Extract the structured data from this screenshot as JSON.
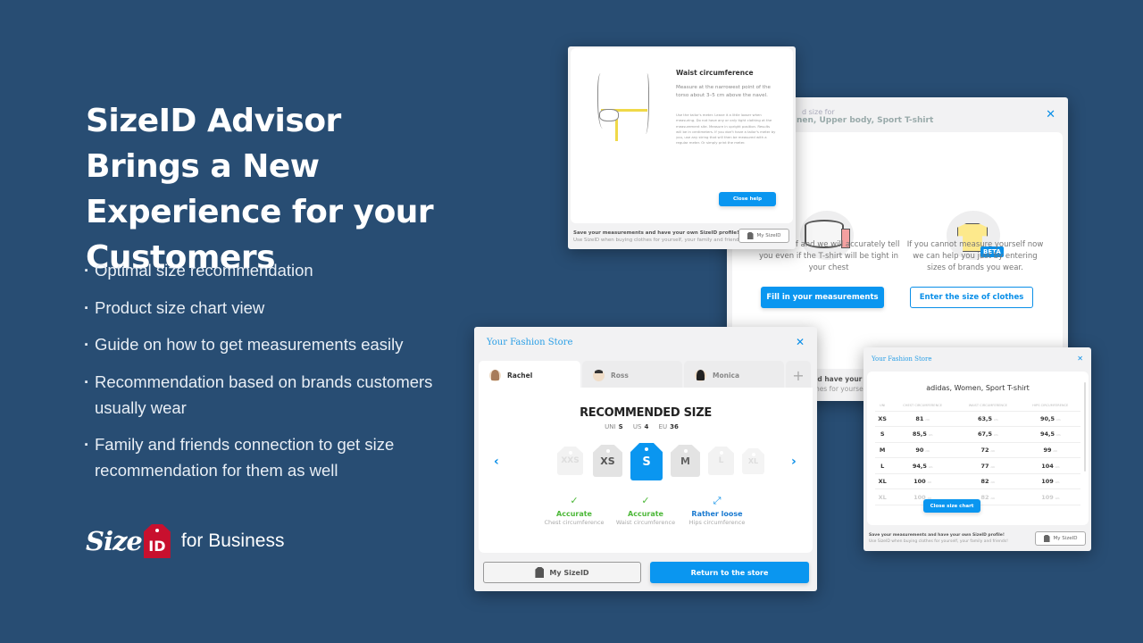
{
  "colors": {
    "background": "#284d73",
    "accent": "#0a96f0",
    "brand_red": "#c8102e",
    "accurate_green": "#4db839"
  },
  "headline": "SizeID Advisor Brings a New Experience for your Customers",
  "features": [
    "Optimal size recommendation",
    "Product size chart view",
    "Guide on how to get measurements easily",
    "Recommendation based on brands customers usually wear",
    "Family and friends connection to get size recommendation for them as well"
  ],
  "brand": {
    "size": "Size",
    "id": "ID",
    "suffix": "for Business"
  },
  "help_window": {
    "title": "Waist circumference",
    "subtitle": "Measure at the narrowest point of the torso about 3–5 cm above the navel.",
    "body": "Use the tailor's meter. Leave it a little looser when measuring. Do not have any or only tight clothing at the measurement site. Measure in upright position. Results will be in centimeters. If you don't have a tailor's meter by you, use any string that will then be measured with a regular meter. Or simply print the meter.",
    "close_button": "Close help",
    "footer_line1": "Save your measurements and have your own SizeID profile!",
    "footer_line2": "Use SizeID when buying clothes for yourself, your family and friends!",
    "mysizeid_button": "My SizeID"
  },
  "find_window": {
    "subtitle": "d size for",
    "title": "nen, Upper body, Sport T-shirt",
    "measure_text": "re yourself and we will accurately tell you even if the T-shirt will be tight in your chest",
    "brands_text": "If you cannot measure yourself now we can help you just by entering sizes of brands you wear.",
    "beta_badge": "BETA",
    "fill_button": "Fill in your measurements",
    "enter_button": "Enter the size of clothes",
    "footer_line1": "nd have your ow",
    "footer_line2": "thes for yourse"
  },
  "rec_window": {
    "store_name": "Your Fashion Store",
    "tabs": [
      {
        "name": "Rachel",
        "active": true
      },
      {
        "name": "Ross",
        "active": false
      },
      {
        "name": "Monica",
        "active": false
      }
    ],
    "title": "RECOMMENDED SIZE",
    "size_systems": [
      {
        "label": "UNI",
        "value": "S"
      },
      {
        "label": "US",
        "value": "4"
      },
      {
        "label": "EU",
        "value": "36"
      }
    ],
    "size_options": [
      "XXS",
      "XS",
      "S",
      "M",
      "L",
      "XL"
    ],
    "selected_size": "S",
    "fit": [
      {
        "status": "Accurate",
        "label": "Chest circumference",
        "icon": "check"
      },
      {
        "status": "Accurate",
        "label": "Waist circumference",
        "icon": "check"
      },
      {
        "status": "Rather loose",
        "label": "Hips circumference",
        "icon": "expand"
      }
    ],
    "mysizeid_button": "My SizeID",
    "return_button": "Return to the store"
  },
  "chart_window": {
    "store_name": "Your Fashion Store",
    "product": "adidas, Women, Sport T-shirt",
    "columns": [
      "UNI",
      "CHEST CIRCUMFERENCE",
      "WAIST CIRCUMFERENCE",
      "HIPS CIRCUMFERENCE"
    ],
    "unit": "cm",
    "rows": [
      [
        "XS",
        "81",
        "63,5",
        "90,5"
      ],
      [
        "S",
        "85,5",
        "67,5",
        "94,5"
      ],
      [
        "M",
        "90",
        "72",
        "99"
      ],
      [
        "L",
        "94,5",
        "77",
        "104"
      ],
      [
        "XL",
        "100",
        "82",
        "109"
      ],
      [
        "XL",
        "100",
        "82",
        "109"
      ]
    ],
    "close_button": "Close size chart",
    "footer_line1": "Save your measurements and have your own SizeID profile!",
    "footer_line2": "Use SizeID when buying clothes for yourself, your family and friends!",
    "mysizeid_button": "My SizeID"
  }
}
